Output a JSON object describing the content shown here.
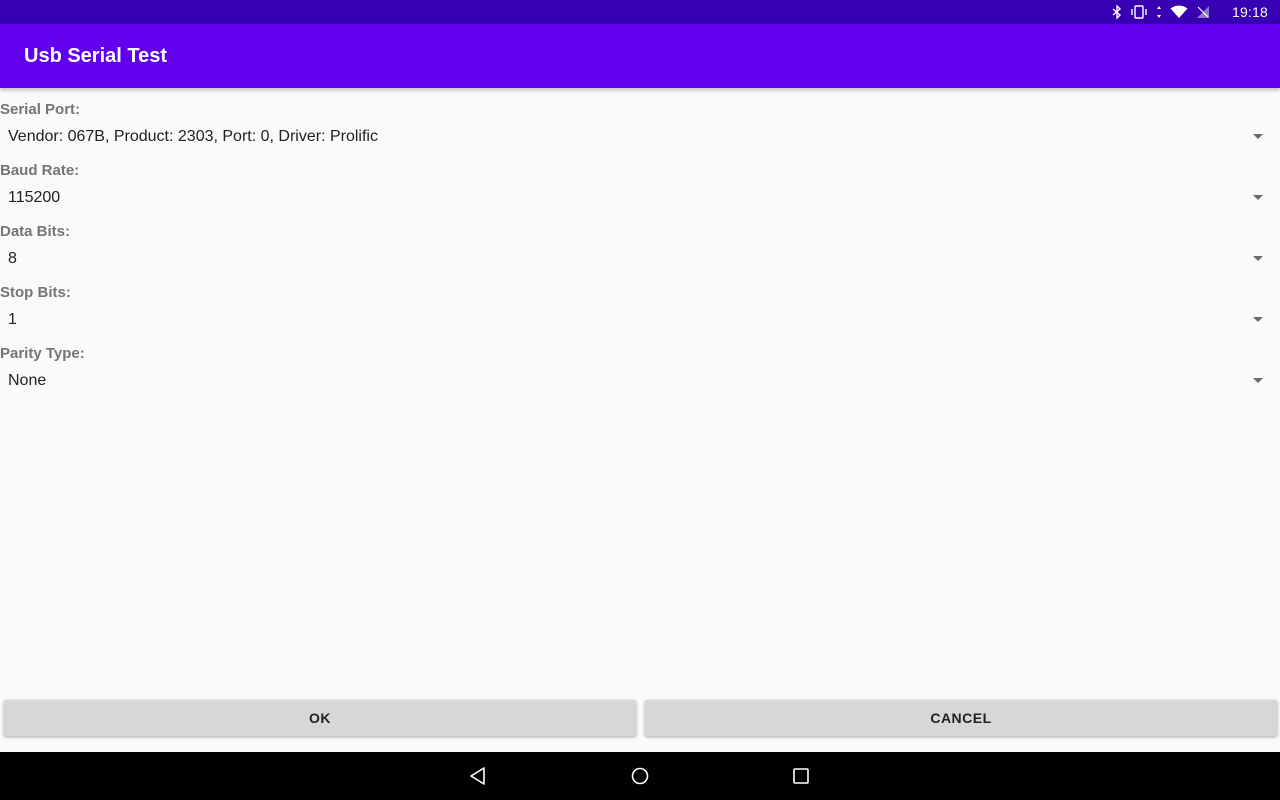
{
  "status_bar": {
    "time": "19:18",
    "icons": [
      "bluetooth-icon",
      "vibrate-icon",
      "data-arrows-icon",
      "wifi-icon",
      "no-sim-icon"
    ]
  },
  "app_bar": {
    "title": "Usb Serial Test"
  },
  "form": {
    "serial_port": {
      "label": "Serial Port:",
      "value": "Vendor: 067B, Product: 2303, Port: 0, Driver: Prolific"
    },
    "baud_rate": {
      "label": "Baud Rate:",
      "value": "115200"
    },
    "data_bits": {
      "label": "Data Bits:",
      "value": "8"
    },
    "stop_bits": {
      "label": "Stop Bits:",
      "value": "1"
    },
    "parity_type": {
      "label": "Parity Type:",
      "value": "None"
    }
  },
  "buttons": {
    "ok": "OK",
    "cancel": "CANCEL"
  },
  "nav_bar": {
    "icons": [
      "back-icon",
      "home-icon",
      "recents-icon"
    ]
  },
  "colors": {
    "status_bar": "#3700b3",
    "app_bar": "#6200ee",
    "background": "#fafafa",
    "label": "#757575",
    "button": "#d6d7d7"
  }
}
